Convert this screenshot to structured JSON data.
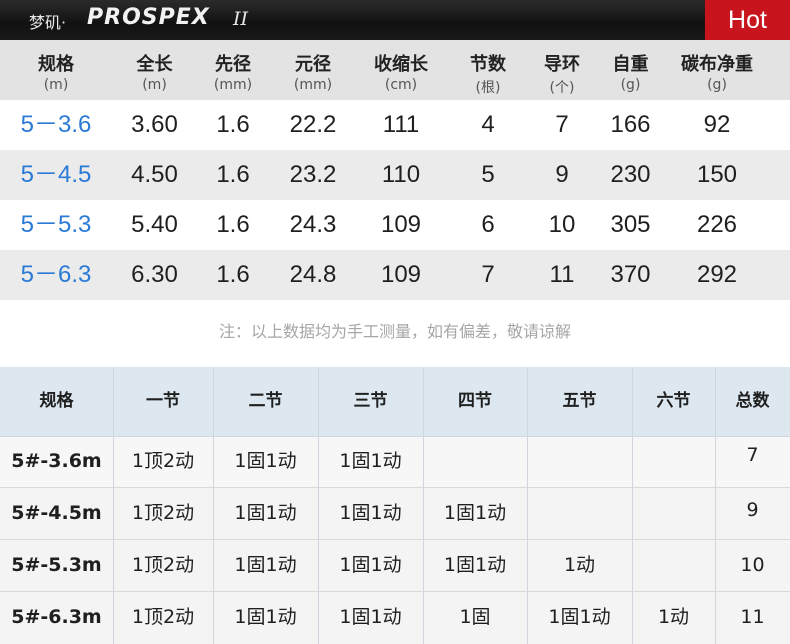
{
  "header": {
    "brand_cn": "梦矶·",
    "brand_logo": "PROSPEX",
    "brand_suffix": "II",
    "hot_badge": "Hot"
  },
  "spec_table": {
    "columns": [
      {
        "name": "规格",
        "unit": "(m)"
      },
      {
        "name": "全长",
        "unit": "(m)"
      },
      {
        "name": "先径",
        "unit": "(mm)"
      },
      {
        "name": "元径",
        "unit": "(mm)"
      },
      {
        "name": "收缩长",
        "unit": "(cm)"
      },
      {
        "name": "节数",
        "unit": "(根)"
      },
      {
        "name": "导环",
        "unit": "(个)"
      },
      {
        "name": "自重",
        "unit": "(g)"
      },
      {
        "name": "碳布净重",
        "unit": "(g)"
      }
    ],
    "rows": [
      [
        "5－3.6",
        "3.60",
        "1.6",
        "22.2",
        "111",
        "4",
        "7",
        "166",
        "92"
      ],
      [
        "5－4.5",
        "4.50",
        "1.6",
        "23.2",
        "110",
        "5",
        "9",
        "230",
        "150"
      ],
      [
        "5－5.3",
        "5.40",
        "1.6",
        "24.3",
        "109",
        "6",
        "10",
        "305",
        "226"
      ],
      [
        "5－6.3",
        "6.30",
        "1.6",
        "24.8",
        "109",
        "7",
        "11",
        "370",
        "292"
      ]
    ],
    "note": "注：以上数据均为手工测量，如有偏差，敬请谅解"
  },
  "section_table": {
    "columns": [
      "规格",
      "一节",
      "二节",
      "三节",
      "四节",
      "五节",
      "六节",
      "总数"
    ],
    "rows": [
      [
        "5#-3.6m",
        "1顶2动",
        "1固1动",
        "1固1动",
        "",
        "",
        "",
        "7"
      ],
      [
        "5#-4.5m",
        "1顶2动",
        "1固1动",
        "1固1动",
        "1固1动",
        "",
        "",
        "9"
      ],
      [
        "5#-5.3m",
        "1顶2动",
        "1固1动",
        "1固1动",
        "1固1动",
        "1动",
        "",
        "10"
      ],
      [
        "5#-6.3m",
        "1顶2动",
        "1固1动",
        "1固1动",
        "1固",
        "1固1动",
        "1动",
        "11"
      ]
    ]
  }
}
